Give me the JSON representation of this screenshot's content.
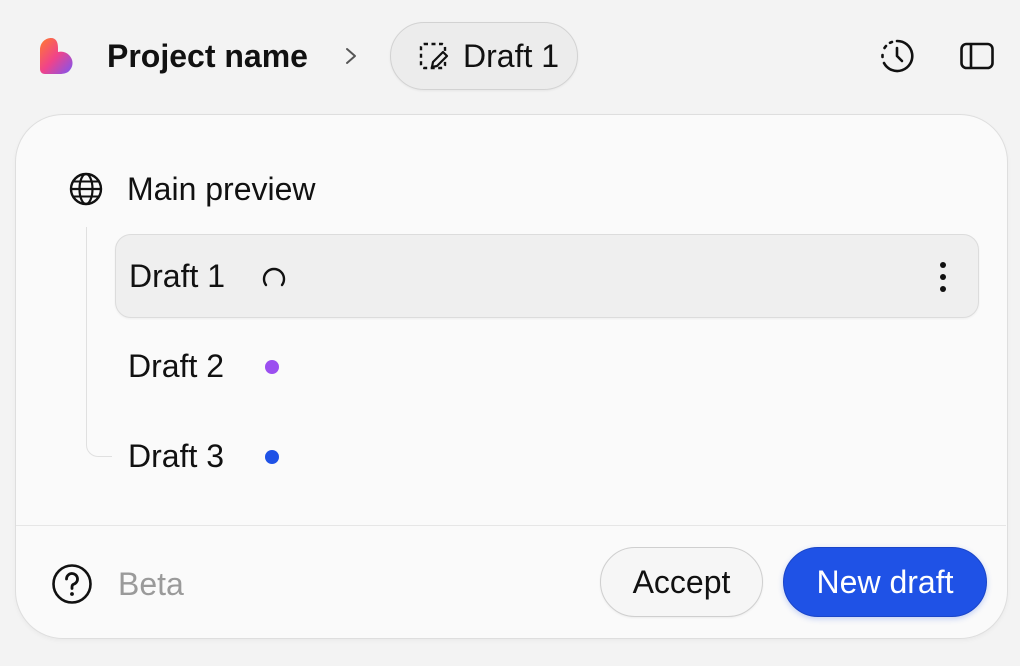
{
  "header": {
    "logo_icon": "lovable-heart-logo",
    "project_name": "Project name",
    "breadcrumb_separator_icon": "chevron-right-icon",
    "current_draft": {
      "icon": "draft-edit-icon",
      "label": "Draft 1"
    },
    "actions": [
      {
        "icon": "history-icon"
      },
      {
        "icon": "sidebar-toggle-icon"
      }
    ]
  },
  "panel": {
    "main_preview": {
      "icon": "globe-icon",
      "label": "Main preview"
    },
    "drafts": [
      {
        "label": "Draft 1",
        "status": "loading",
        "active": true
      },
      {
        "label": "Draft 2",
        "status_color": "#9b4ff0",
        "active": false
      },
      {
        "label": "Draft 3",
        "status_color": "#1f52e6",
        "active": false
      }
    ],
    "footer": {
      "help_icon": "question-circle-icon",
      "beta_label": "Beta",
      "accept_label": "Accept",
      "new_draft_label": "New draft"
    }
  },
  "colors": {
    "accent": "#1f52e6",
    "background": "#f3f3f3",
    "card": "#fafafa",
    "muted_text": "#9a9a9a"
  }
}
